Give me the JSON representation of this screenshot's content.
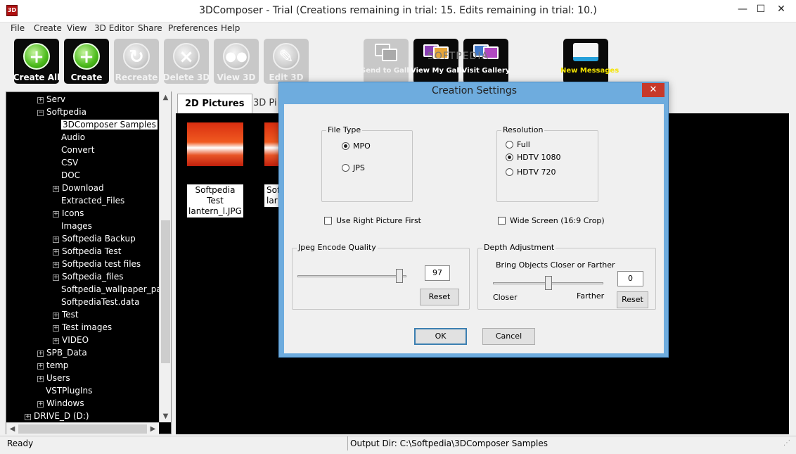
{
  "window": {
    "title": "3DComposer - Trial (Creations remaining in trial: 15. Edits remaining in trial: 10.)",
    "app_icon_text": "3D",
    "min_glyph": "—",
    "max_glyph": "☐",
    "close_glyph": "✕"
  },
  "menu": [
    "File",
    "Create",
    "View",
    "3D Editor",
    "Share",
    "Preferences",
    "Help"
  ],
  "toolbar": {
    "create_all": "Create All",
    "create": "Create",
    "recreate": "Recreate",
    "delete_3d": "Delete 3D",
    "view_3d": "View 3D",
    "edit_3d": "Edit 3D",
    "send_to_gallery": "Send to Gallery",
    "view_my_gallery": "View My Gallery",
    "visit_gallery": "Visit Gallery",
    "new_messages": "New Messages",
    "watermark": "SOFTPEDIA"
  },
  "tree": {
    "items": [
      {
        "label": "Serv",
        "expander": "+"
      },
      {
        "label": "Softpedia",
        "expander": "−"
      },
      {
        "label": "3DComposer Samples",
        "expander": ""
      },
      {
        "label": "Audio",
        "expander": ""
      },
      {
        "label": "Convert",
        "expander": ""
      },
      {
        "label": "CSV",
        "expander": ""
      },
      {
        "label": "DOC",
        "expander": ""
      },
      {
        "label": "Download",
        "expander": "+"
      },
      {
        "label": "Extracted_Files",
        "expander": ""
      },
      {
        "label": "Icons",
        "expander": "+"
      },
      {
        "label": "Images",
        "expander": ""
      },
      {
        "label": "Softpedia Backup",
        "expander": "+"
      },
      {
        "label": "Softpedia Test",
        "expander": "+"
      },
      {
        "label": "Softpedia test files",
        "expander": "+"
      },
      {
        "label": "Softpedia_files",
        "expander": "+"
      },
      {
        "label": "Softpedia_wallpaper_pack_",
        "expander": ""
      },
      {
        "label": "SoftpediaTest.data",
        "expander": ""
      },
      {
        "label": "Test",
        "expander": "+"
      },
      {
        "label": "Test images",
        "expander": "+"
      },
      {
        "label": "VIDEO",
        "expander": "+"
      },
      {
        "label": "SPB_Data",
        "expander": "+"
      },
      {
        "label": "temp",
        "expander": "+"
      },
      {
        "label": "Users",
        "expander": "+"
      },
      {
        "label": "VSTPlugIns",
        "expander": ""
      },
      {
        "label": "Windows",
        "expander": "+"
      },
      {
        "label": "DRIVE_D (D:)",
        "expander": "+"
      }
    ],
    "selected_index": 2
  },
  "tabs": [
    "2D Pictures",
    "3D Pi"
  ],
  "thumbnails": [
    {
      "caption_line1": "Softpedia Test",
      "caption_line2": "lantern_l.JPG"
    },
    {
      "caption_line1": "Sof",
      "caption_line2": "lar"
    }
  ],
  "status": {
    "left": "Ready",
    "right": "Output Dir: C:\\Softpedia\\3DComposer Samples"
  },
  "dialog": {
    "title": "Creation Settings",
    "close_glyph": "✕",
    "file_type": {
      "label": "File Type",
      "options": [
        "MPO",
        "JPS"
      ],
      "selected": "MPO"
    },
    "resolution": {
      "label": "Resolution",
      "options": [
        "Full",
        "HDTV 1080",
        "HDTV 720"
      ],
      "selected": "HDTV 1080"
    },
    "use_right_picture_first": "Use Right Picture First",
    "wide_screen": "Wide Screen (16:9 Crop)",
    "jpeg": {
      "label": "Jpeg Encode Quality",
      "value": "97",
      "reset": "Reset"
    },
    "depth": {
      "label": "Depth Adjustment",
      "caption": "Bring Objects Closer or Farther",
      "value": "0",
      "closer": "Closer",
      "farther": "Farther",
      "reset": "Reset"
    },
    "ok": "OK",
    "cancel": "Cancel"
  }
}
